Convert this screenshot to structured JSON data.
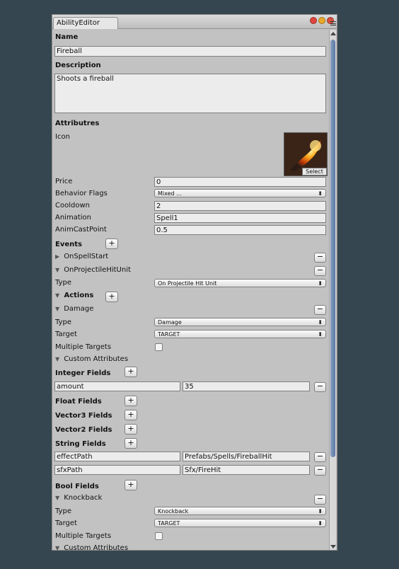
{
  "window": {
    "tab_title": "AbilityEditor"
  },
  "name": {
    "label": "Name",
    "value": "Fireball"
  },
  "description": {
    "label": "Description",
    "value": "Shoots a fireball"
  },
  "attributes": {
    "header": "Attributres",
    "icon_label": "Icon",
    "select_label": "Select",
    "price": {
      "label": "Price",
      "value": "0"
    },
    "behavior_flags": {
      "label": "Behavior Flags",
      "value": "Mixed ..."
    },
    "cooldown": {
      "label": "Cooldown",
      "value": "2"
    },
    "animation": {
      "label": "Animation",
      "value": "Spell1"
    },
    "anim_cast_point": {
      "label": "AnimCastPoint",
      "value": "0.5"
    }
  },
  "events": {
    "header": "Events",
    "on_spell_start": "OnSpellStart",
    "on_projectile_hit_unit": "OnProjectileHitUnit",
    "type": {
      "label": "Type",
      "value": "On Projectile Hit Unit"
    }
  },
  "actions": {
    "header": "Actions",
    "damage": {
      "label": "Damage",
      "type": {
        "label": "Type",
        "value": "Damage"
      },
      "target": {
        "label": "Target",
        "value": "TARGET"
      },
      "multiple_targets": "Multiple Targets",
      "custom_attributes": "Custom Attributes"
    }
  },
  "fields": {
    "integer": {
      "header": "Integer Fields",
      "rows": [
        {
          "key": "amount",
          "value": "35"
        }
      ]
    },
    "float_header": "Float Fields",
    "vector3_header": "Vector3 Fields",
    "vector2_header": "Vector2 Fields",
    "string": {
      "header": "String Fields",
      "rows": [
        {
          "key": "effectPath",
          "value": "Prefabs/Spells/FireballHit"
        },
        {
          "key": "sfxPath",
          "value": "Sfx/FireHit"
        }
      ]
    },
    "bool_header": "Bool Fields"
  },
  "knockback": {
    "label": "Knockback",
    "type": {
      "label": "Type",
      "value": "Knockback"
    },
    "target": {
      "label": "Target",
      "value": "TARGET"
    },
    "multiple_targets": "Multiple Targets",
    "custom_attributes": "Custom Attributes"
  },
  "glyphs": {
    "plus": "+",
    "minus": "−",
    "dropdown": "⬍",
    "tri_right": "▶",
    "tri_down": "▼"
  },
  "colors": {
    "background": "#364650",
    "panel": "#c2c2c2",
    "close": "#e0443e",
    "minimize": "#e8a82a",
    "maximize": "#d6503d"
  }
}
